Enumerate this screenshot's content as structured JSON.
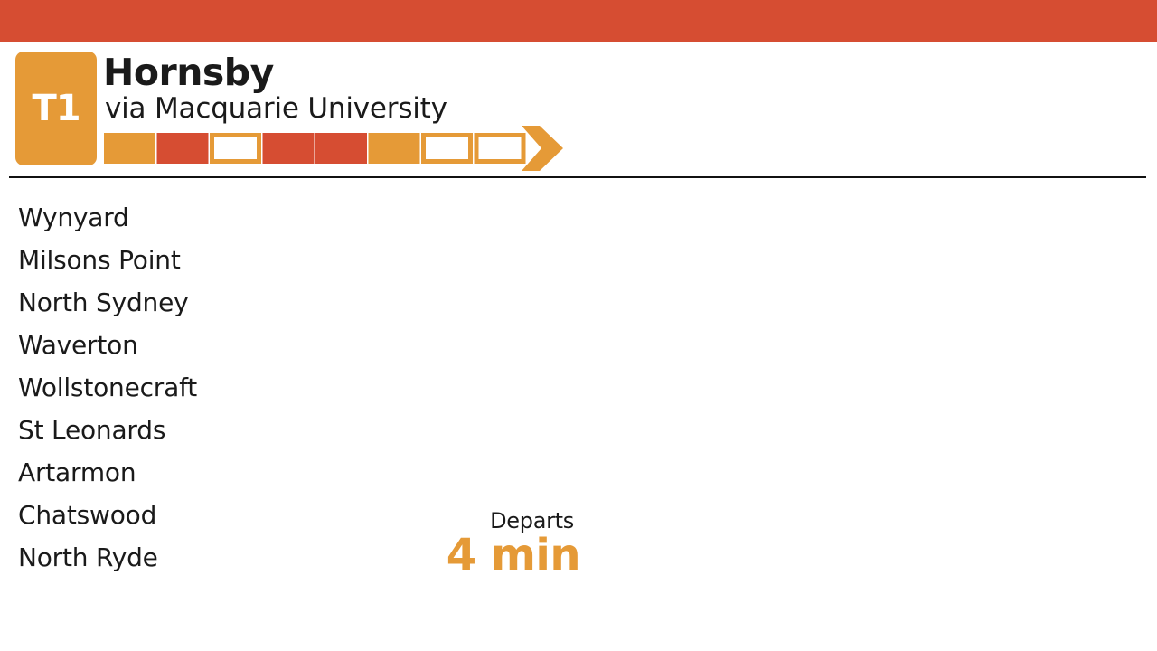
{
  "colors": {
    "header_bar": "#d64d32",
    "line_badge": "#e59a37",
    "car_orange": "#e59a37",
    "car_red": "#d64d32",
    "departs_value": "#e59a37"
  },
  "service": {
    "line": "T1",
    "destination": "Hornsby",
    "via": "via Macquarie University"
  },
  "train": {
    "cars": [
      {
        "style": "orange"
      },
      {
        "style": "red"
      },
      {
        "style": "outline"
      },
      {
        "style": "red"
      },
      {
        "style": "red"
      },
      {
        "style": "orange"
      },
      {
        "style": "outline"
      },
      {
        "style": "outline"
      }
    ],
    "direction_icon": "arrow-right-icon"
  },
  "stops": [
    "Wynyard",
    "Milsons Point",
    "North Sydney",
    "Waverton",
    "Wollstonecraft",
    "St Leonards",
    "Artarmon",
    "Chatswood",
    "North Ryde"
  ],
  "departure": {
    "label": "Departs",
    "value": "4 min"
  }
}
